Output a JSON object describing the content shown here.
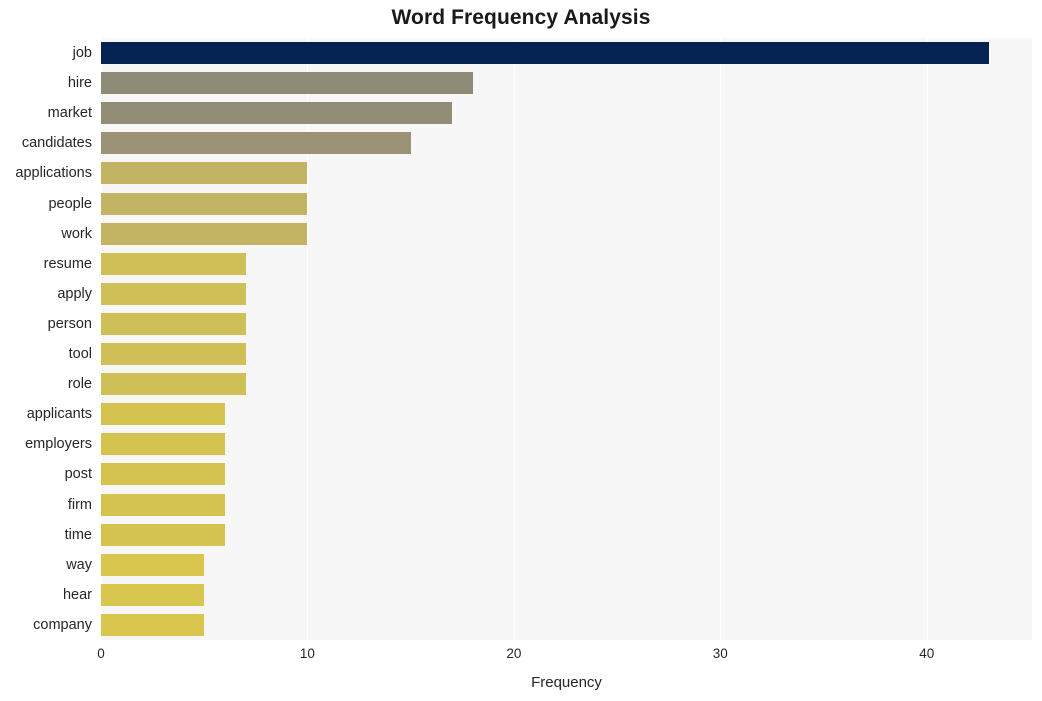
{
  "chart_data": {
    "type": "bar",
    "orientation": "horizontal",
    "title": "Word Frequency Analysis",
    "xlabel": "Frequency",
    "ylabel": "",
    "categories": [
      "job",
      "hire",
      "market",
      "candidates",
      "applications",
      "people",
      "work",
      "resume",
      "apply",
      "person",
      "tool",
      "role",
      "applicants",
      "employers",
      "post",
      "firm",
      "time",
      "way",
      "hear",
      "company"
    ],
    "values": [
      43,
      18,
      17,
      15,
      10,
      10,
      10,
      7,
      7,
      7,
      7,
      7,
      6,
      6,
      6,
      6,
      6,
      5,
      5,
      5
    ],
    "bar_colors": [
      "#042252",
      "#8e8a78",
      "#928d77",
      "#9c9377",
      "#c2b463",
      "#c2b463",
      "#c2b463",
      "#cfbf57",
      "#cfbf57",
      "#cfbf57",
      "#cfbf57",
      "#cfbf57",
      "#d5c350",
      "#d5c350",
      "#d5c350",
      "#d5c350",
      "#d5c350",
      "#d9c64e",
      "#d9c64e",
      "#d9c64e"
    ],
    "xlim": [
      0,
      45.1
    ],
    "xticks": [
      0,
      10,
      20,
      30,
      40
    ],
    "xtick_labels": [
      "0",
      "10",
      "20",
      "30",
      "40"
    ],
    "grid": true,
    "grid_axis": "x",
    "legend": null,
    "plot_background": "#f7f7f7",
    "figure_background": "#ffffff",
    "gridline_color": "#ffffff"
  }
}
